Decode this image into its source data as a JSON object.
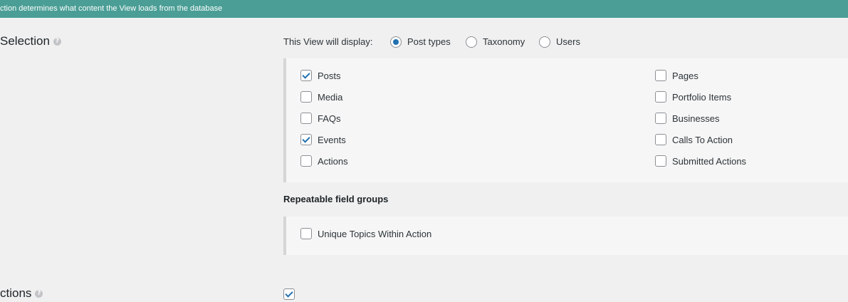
{
  "banner": {
    "text": "ction determines what content the View loads from the database"
  },
  "section": {
    "title": "Selection",
    "help_icon": "question-circle-icon"
  },
  "display": {
    "label": "This View will display:",
    "options": [
      {
        "label": "Post types",
        "checked": true
      },
      {
        "label": "Taxonomy",
        "checked": false
      },
      {
        "label": "Users",
        "checked": false
      }
    ]
  },
  "post_types": {
    "left": [
      {
        "label": "Posts",
        "checked": true
      },
      {
        "label": "Media",
        "checked": false
      },
      {
        "label": "FAQs",
        "checked": false
      },
      {
        "label": "Events",
        "checked": true
      },
      {
        "label": "Actions",
        "checked": false
      }
    ],
    "right": [
      {
        "label": "Pages",
        "checked": false
      },
      {
        "label": "Portfolio Items",
        "checked": false
      },
      {
        "label": "Businesses",
        "checked": false
      },
      {
        "label": "Calls To Action",
        "checked": false
      },
      {
        "label": "Submitted Actions",
        "checked": false
      }
    ]
  },
  "repeatable": {
    "heading": "Repeatable field groups",
    "items": [
      {
        "label": "Unique Topics Within Action",
        "checked": false
      }
    ]
  },
  "next_section": {
    "title": "ctions",
    "checkbox_checked": true
  }
}
